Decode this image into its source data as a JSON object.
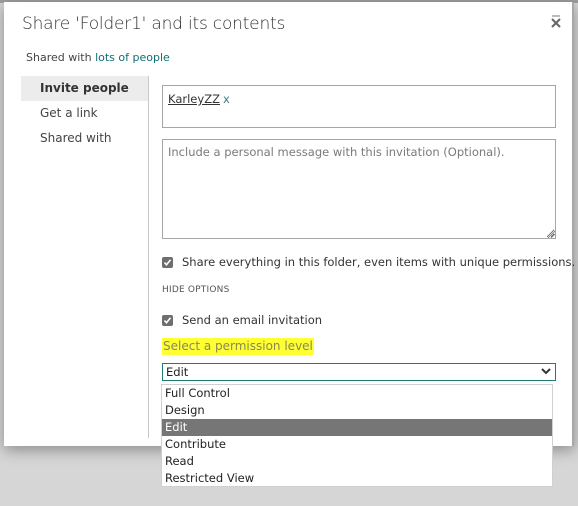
{
  "dialog": {
    "title": "Share 'Folder1' and its contents",
    "shared_with_prefix": "Shared with",
    "shared_with_link": "lots of people",
    "close_icon": "close-icon"
  },
  "sidebar": {
    "items": [
      {
        "label": "Invite people",
        "active": true
      },
      {
        "label": "Get a link",
        "active": false
      },
      {
        "label": "Shared with",
        "active": false
      }
    ]
  },
  "invite": {
    "people": [
      {
        "name": "KarleyZZ",
        "remove_label": "x"
      }
    ],
    "message_placeholder": "Include a personal message with this invitation (Optional).",
    "message_value": "",
    "share_everything": {
      "label": "Share everything in this folder, even items with unique permissions.",
      "checked": true
    },
    "hide_options_label": "HIDE OPTIONS",
    "send_email": {
      "label": "Send an email invitation",
      "checked": true
    },
    "permission_label": "Select a permission level",
    "permission_selected": "Edit",
    "permission_options": [
      "Full Control",
      "Design",
      "Edit",
      "Contribute",
      "Read",
      "Restricted View"
    ]
  },
  "colors": {
    "accent_teal": "#1e7b7b",
    "link": "#0f6e74",
    "highlight_yellow": "#ffff33",
    "selected_option_bg": "#767676"
  }
}
